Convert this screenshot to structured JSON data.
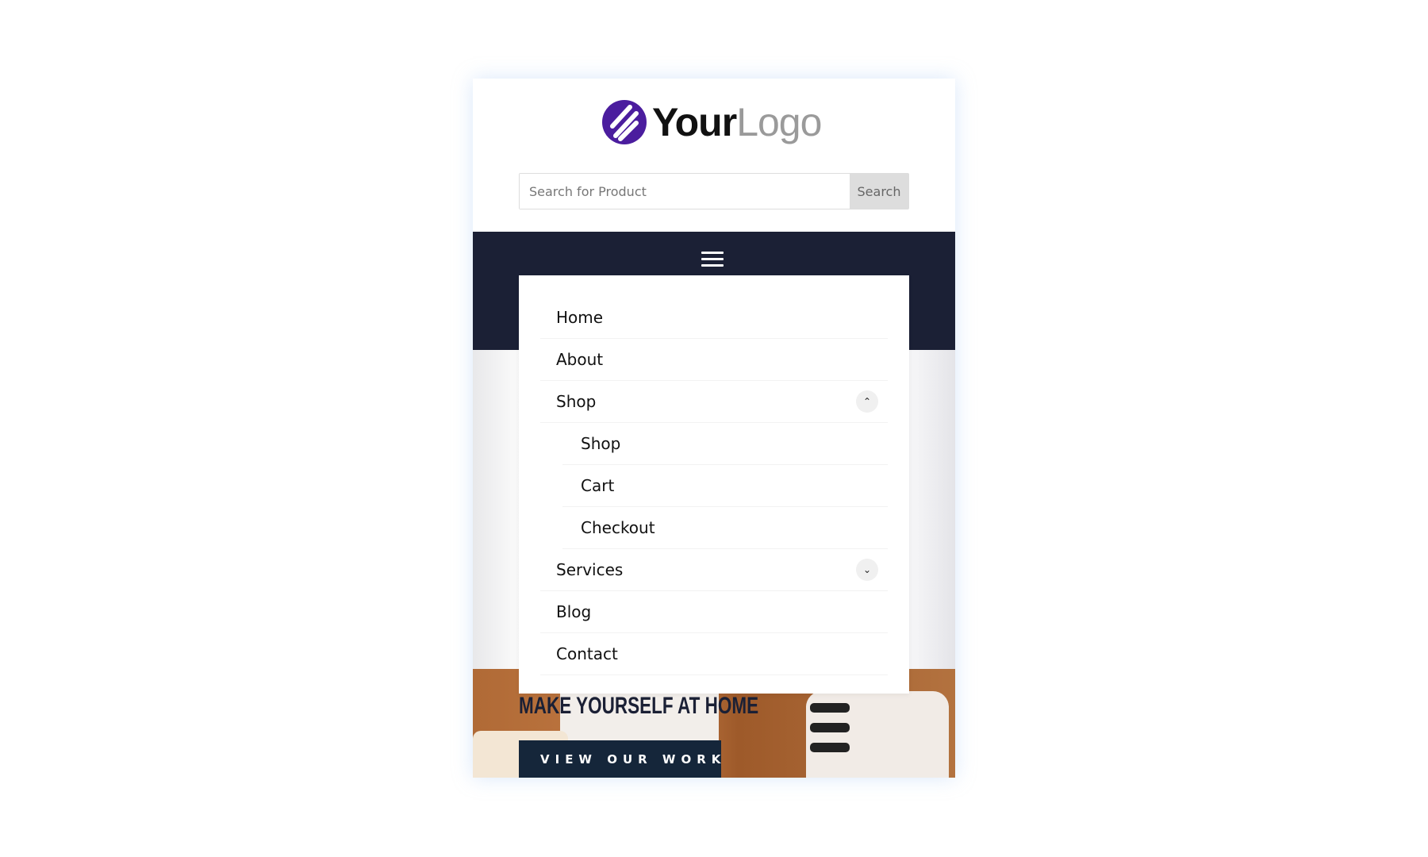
{
  "logo": {
    "part1": "Your",
    "part2": "Logo",
    "color": "#4b1d9e"
  },
  "search": {
    "placeholder": "Search for Product",
    "button": "Search"
  },
  "nav": {
    "menu_icon": "hamburger-icon",
    "bg": "#1b2035"
  },
  "menu": {
    "items": [
      {
        "label": "Home"
      },
      {
        "label": "About"
      },
      {
        "label": "Shop",
        "expanded": true,
        "toggle_icon": "chevron-up-icon",
        "children": [
          {
            "label": "Shop"
          },
          {
            "label": "Cart"
          },
          {
            "label": "Checkout"
          }
        ]
      },
      {
        "label": "Services",
        "expanded": false,
        "toggle_icon": "chevron-down-icon"
      },
      {
        "label": "Blog"
      },
      {
        "label": "Contact"
      }
    ]
  },
  "hero": {
    "headline": "MAKE YOURSELF AT HOME",
    "cta": "VIEW OUR WORK"
  }
}
